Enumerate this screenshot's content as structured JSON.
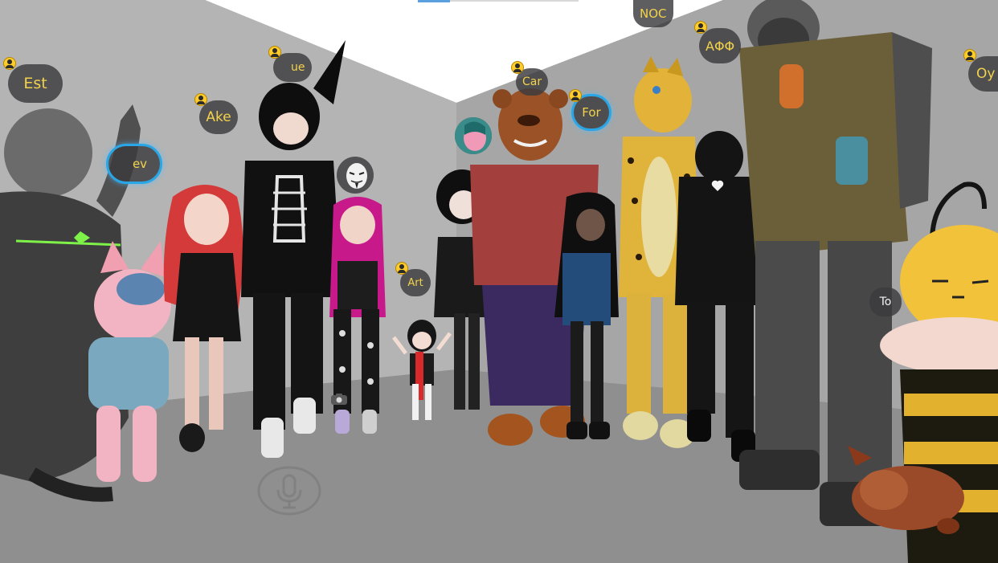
{
  "scene": {
    "colors": {
      "wall_left": "#b5b5b5",
      "wall_right": "#a7a7a7",
      "floor": "#8e8e8e",
      "ceiling": "#ffffff",
      "nameplate_text": "#f2d24a",
      "speaking_ring": "#29a6e6"
    }
  },
  "nameplates": [
    {
      "id": "est",
      "label": "Est"
    },
    {
      "id": "ake",
      "label": "Ake"
    },
    {
      "id": "ev",
      "label": "ev"
    },
    {
      "id": "ue",
      "label": "ue"
    },
    {
      "id": "art",
      "label": "Art"
    },
    {
      "id": "car",
      "label": "Car"
    },
    {
      "id": "for",
      "label": "For"
    },
    {
      "id": "noc",
      "label": "NOC"
    },
    {
      "id": "adf",
      "label": "ΑΦΦ"
    },
    {
      "id": "oy",
      "label": "Oy"
    },
    {
      "id": "to",
      "label": "To"
    }
  ],
  "avatar_plates": [
    {
      "id": "anon",
      "icon": "anonymous-mask-icon"
    },
    {
      "id": "pink",
      "icon": "pink-face-avatar-icon"
    }
  ],
  "hud": {
    "mic_icon": "microphone-icon",
    "camera_icon": "camera-icon",
    "status_icon": "user-status-icon"
  }
}
